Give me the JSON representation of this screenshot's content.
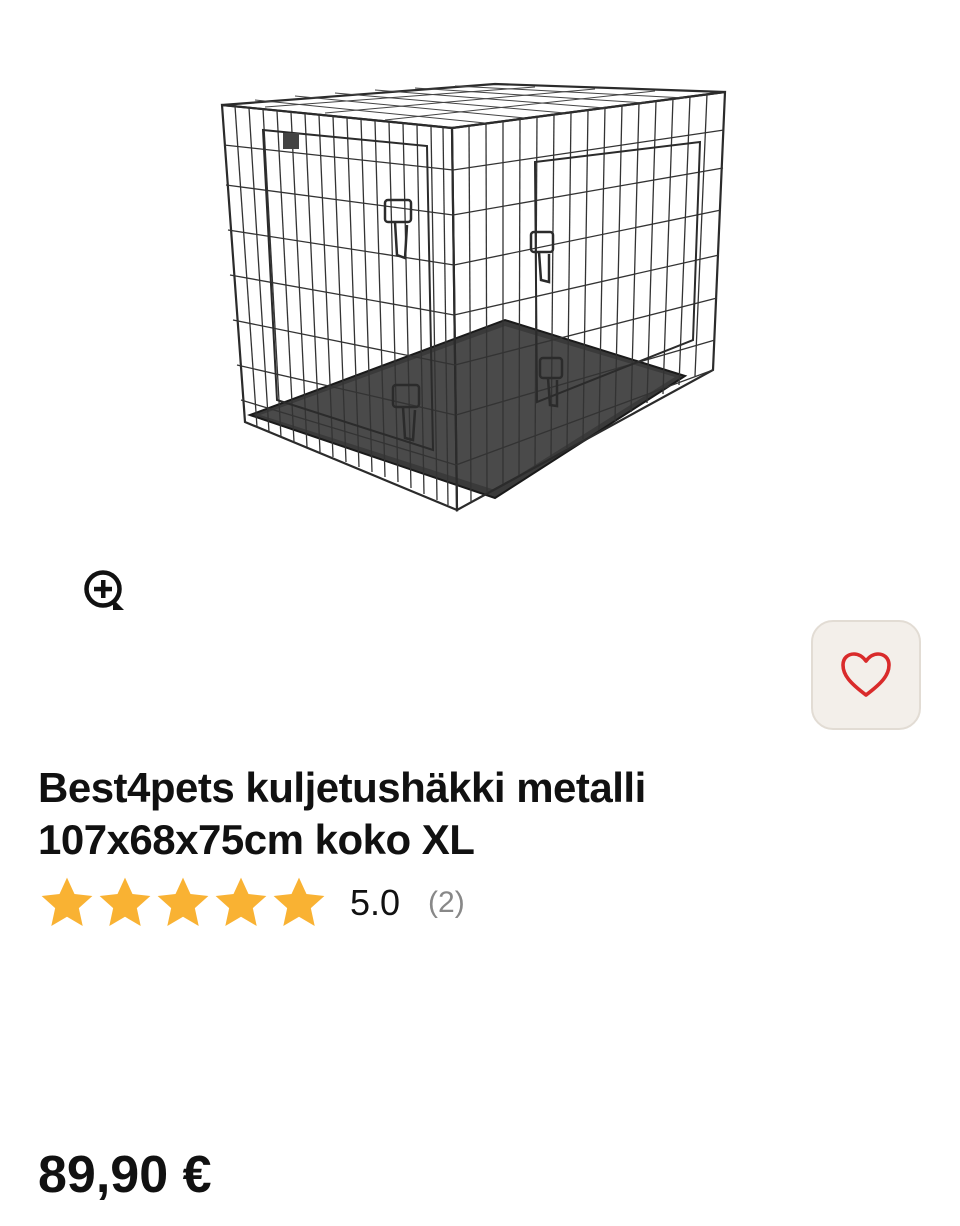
{
  "product": {
    "image": {
      "icon": "dog-crate-image"
    },
    "zoom": {
      "icon": "zoom-in-icon"
    },
    "favorite": {
      "icon": "heart-icon",
      "color": "#d92b2b",
      "background": "#f3efea"
    },
    "title_lines": [
      "Best4pets kuljetushäkki metalli",
      "107x68x75cm koko XL"
    ],
    "rating": {
      "stars": 5,
      "value": "5.0",
      "count": "(2)",
      "star_color": "#f9b233"
    },
    "price": "89,90 €"
  }
}
